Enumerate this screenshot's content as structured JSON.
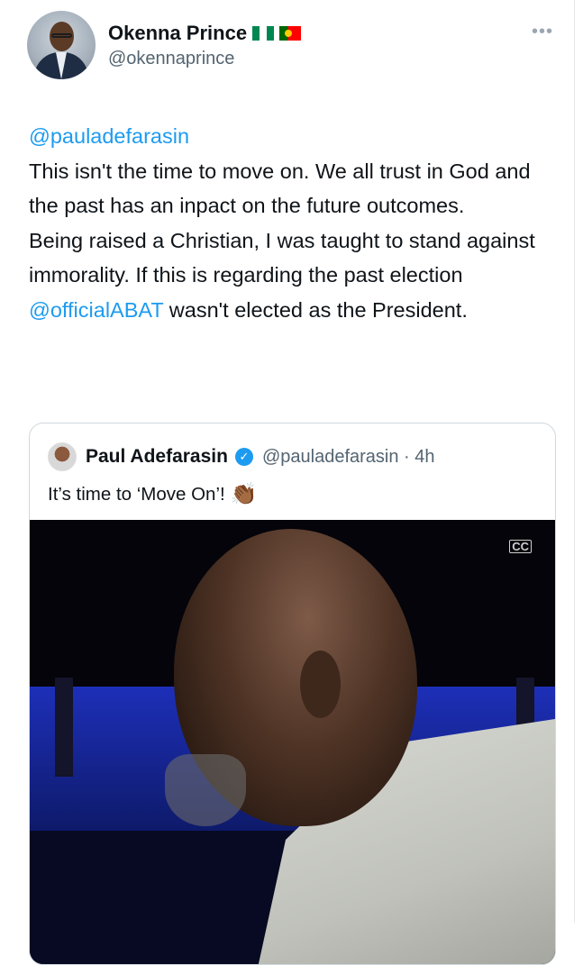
{
  "author": {
    "display_name": "Okenna Prince",
    "handle": "@okennaprince",
    "flags": [
      "nigeria-flag",
      "portugal-flag"
    ]
  },
  "menu": {
    "more_label": "•••"
  },
  "tweet": {
    "reply_mention": "@pauladefarasin",
    "line1": "This isn't the time to move on. We all trust in God and the past has an inpact on the future outcomes.",
    "line2a": "Being raised a Christian, I was taught to stand against immorality. If this is regarding the past election ",
    "mention2": "@officialABAT",
    "line2b": " wasn't elected as the President."
  },
  "quoted_tweet": {
    "display_name": "Paul Adefarasin",
    "verified_icon": "verified-badge-icon",
    "handle_time": "@pauladefarasin · 4h",
    "text": "It’s time to ‘Move On’!",
    "emoji": "👏🏾",
    "video_caption_icon": "CC"
  },
  "colors": {
    "accent": "#1d9bf0",
    "text": "#0f1419",
    "secondary_text": "#536471",
    "border": "#cfd9de"
  }
}
